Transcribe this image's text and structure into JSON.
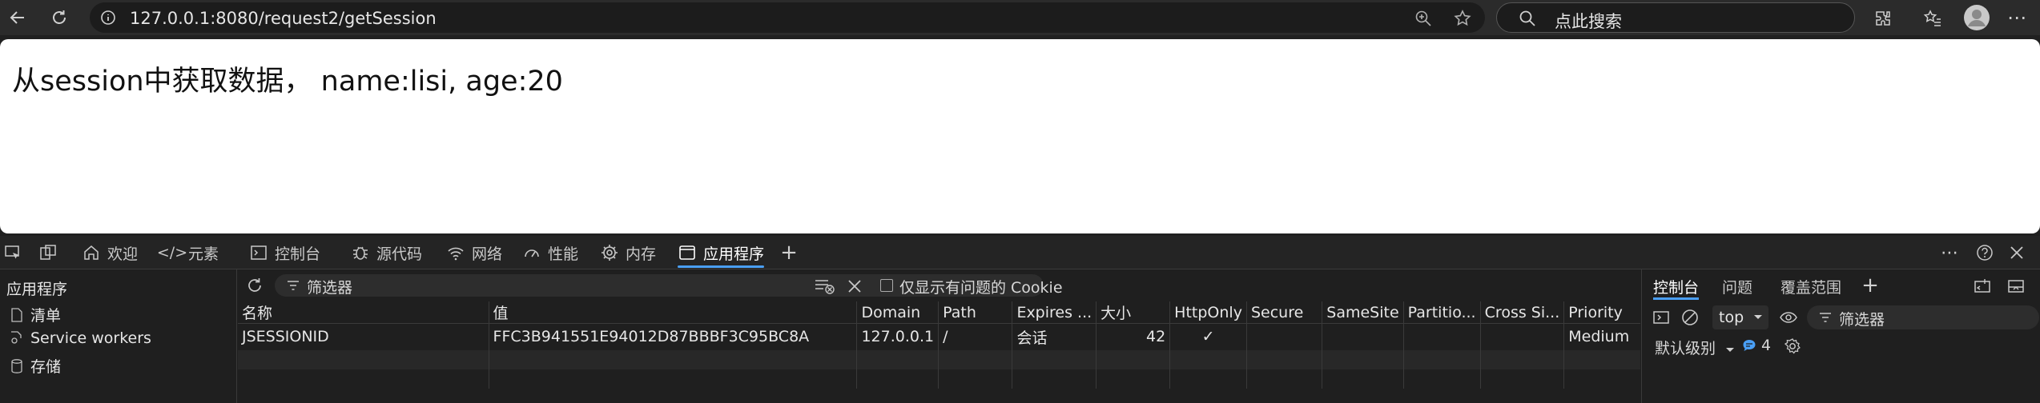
{
  "browser": {
    "url": "127.0.0.1:8080/request2/getSession",
    "search_placeholder": "点此搜索"
  },
  "page": {
    "text": "从session中获取数据， name:lisi, age:20"
  },
  "devtools": {
    "tabs": [
      {
        "label": "欢迎"
      },
      {
        "label": "元素"
      },
      {
        "label": "控制台"
      },
      {
        "label": "源代码"
      },
      {
        "label": "网络"
      },
      {
        "label": "性能"
      },
      {
        "label": "内存"
      },
      {
        "label": "应用程序"
      }
    ],
    "sidebar": {
      "title": "应用程序",
      "items": [
        {
          "label": "清单"
        },
        {
          "label": "Service workers"
        },
        {
          "label": "存储"
        }
      ]
    },
    "filter": {
      "placeholder": "筛选器",
      "only_issues_label": "仅显示有问题的 Cookie"
    },
    "cookies": {
      "headers": [
        "名称",
        "值",
        "Domain",
        "Path",
        "Expires ...",
        "大小",
        "HttpOnly",
        "Secure",
        "SameSite",
        "Partitio...",
        "Cross Si...",
        "Priority"
      ],
      "rows": [
        [
          "JSESSIONID",
          "FFC3B941551E94012D87BBBF3C95BC8A",
          "127.0.0.1",
          "/",
          "会话",
          "42",
          "✓",
          "",
          "",
          "",
          "",
          "Medium"
        ]
      ]
    },
    "drawer": {
      "tabs": [
        {
          "label": "控制台"
        },
        {
          "label": "问题"
        },
        {
          "label": "覆盖范围"
        }
      ],
      "context": "top",
      "filter_placeholder": "筛选器",
      "level": "默认级别",
      "message_count": "4"
    }
  }
}
